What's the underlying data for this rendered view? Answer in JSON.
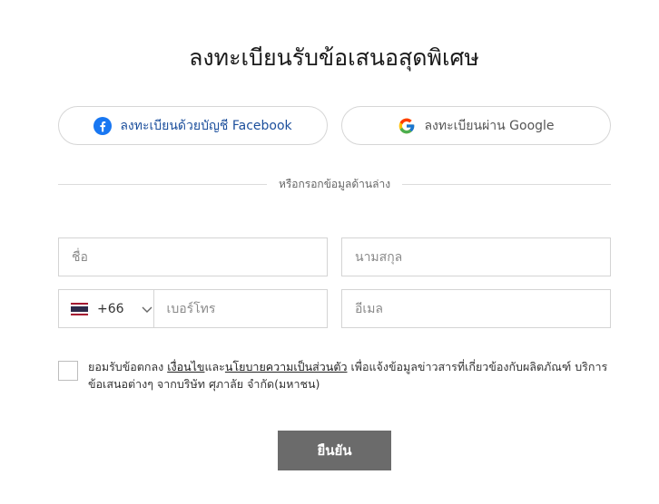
{
  "title": "ลงทะเบียนรับข้อเสนอสุดพิเศษ",
  "social": {
    "facebook_label": "ลงทะเบียนด้วยบัญชี Facebook",
    "google_label": "ลงทะเบียนผ่าน Google"
  },
  "divider_text": "หรือกรอกข้อมูลด้านล่าง",
  "form": {
    "first_name_placeholder": "ชื่อ",
    "last_name_placeholder": "นามสกุล",
    "country_code": "+66",
    "phone_placeholder": "เบอร์โทร",
    "email_placeholder": "อีเมล"
  },
  "consent": {
    "prefix": "ยอมรับข้อตกลง ",
    "terms_link": "เงื่อนไข",
    "and": "และ",
    "privacy_link": "นโยบายความเป็นส่วนตัว",
    "suffix": " เพื่อแจ้งข้อมูลข่าวสารที่เกี่ยวข้องกับผลิตภัณฑ์ บริการ ข้อเสนอต่างๆ จากบริษัท ศุภาลัย จำกัด(มหาชน)"
  },
  "submit_label": "ยืนยัน",
  "colors": {
    "facebook_blue": "#1877f2",
    "facebook_text": "#1c4f9c",
    "submit_bg": "#6b6b6b",
    "border": "#d4d4d4"
  }
}
